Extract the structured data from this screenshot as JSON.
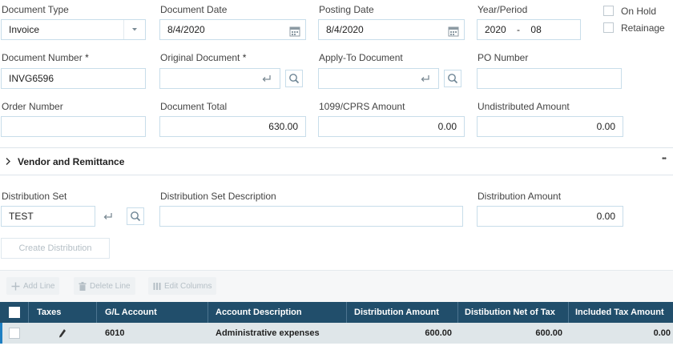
{
  "row1": {
    "document_type": {
      "label": "Document Type",
      "value": "Invoice"
    },
    "document_date": {
      "label": "Document Date",
      "value": "8/4/2020"
    },
    "posting_date": {
      "label": "Posting Date",
      "value": "8/4/2020"
    },
    "year_period": {
      "label": "Year/Period",
      "year": "2020",
      "dash": "-",
      "period": "08"
    },
    "on_hold": {
      "label": "On Hold",
      "checked": false
    },
    "retainage": {
      "label": "Retainage",
      "checked": false
    }
  },
  "row2": {
    "document_number": {
      "label": "Document Number",
      "value": "INVG6596"
    },
    "original_document": {
      "label": "Original Document",
      "value": ""
    },
    "apply_to_document": {
      "label": "Apply-To Document",
      "value": ""
    },
    "po_number": {
      "label": "PO Number",
      "value": ""
    },
    "required_mark": "*"
  },
  "row3": {
    "order_number": {
      "label": "Order Number",
      "value": ""
    },
    "document_total": {
      "label": "Document Total",
      "value": "630.00"
    },
    "cprs_amount": {
      "label": "1099/CPRS Amount",
      "value": "0.00"
    },
    "undistributed_amount": {
      "label": "Undistributed Amount",
      "value": "0.00"
    }
  },
  "section": {
    "title": "Vendor and Remittance",
    "more": "••"
  },
  "distribution": {
    "set": {
      "label": "Distribution Set",
      "value": "TEST"
    },
    "description": {
      "label": "Distribution Set Description",
      "value": ""
    },
    "amount": {
      "label": "Distribution Amount",
      "value": "0.00"
    },
    "create_button": "Create Distribution"
  },
  "toolbar": {
    "add_line": "Add Line",
    "delete_line": "Delete Line",
    "edit_columns": "Edit Columns"
  },
  "grid": {
    "columns": [
      "Taxes",
      "G/L Account",
      "Account Description",
      "Distribution Amount",
      "Distibution Net of Tax",
      "Included Tax Amount"
    ],
    "rows": [
      {
        "gl_account": "6010",
        "description": "Administrative expenses",
        "distribution_amount": "600.00",
        "net_of_tax": "600.00",
        "included_tax": "0.00"
      }
    ]
  },
  "colors": {
    "accent": "#1e7fc2",
    "grid_header": "#214e6b",
    "field_border": "#c8ddea",
    "row_bg": "#dfe6e9"
  }
}
